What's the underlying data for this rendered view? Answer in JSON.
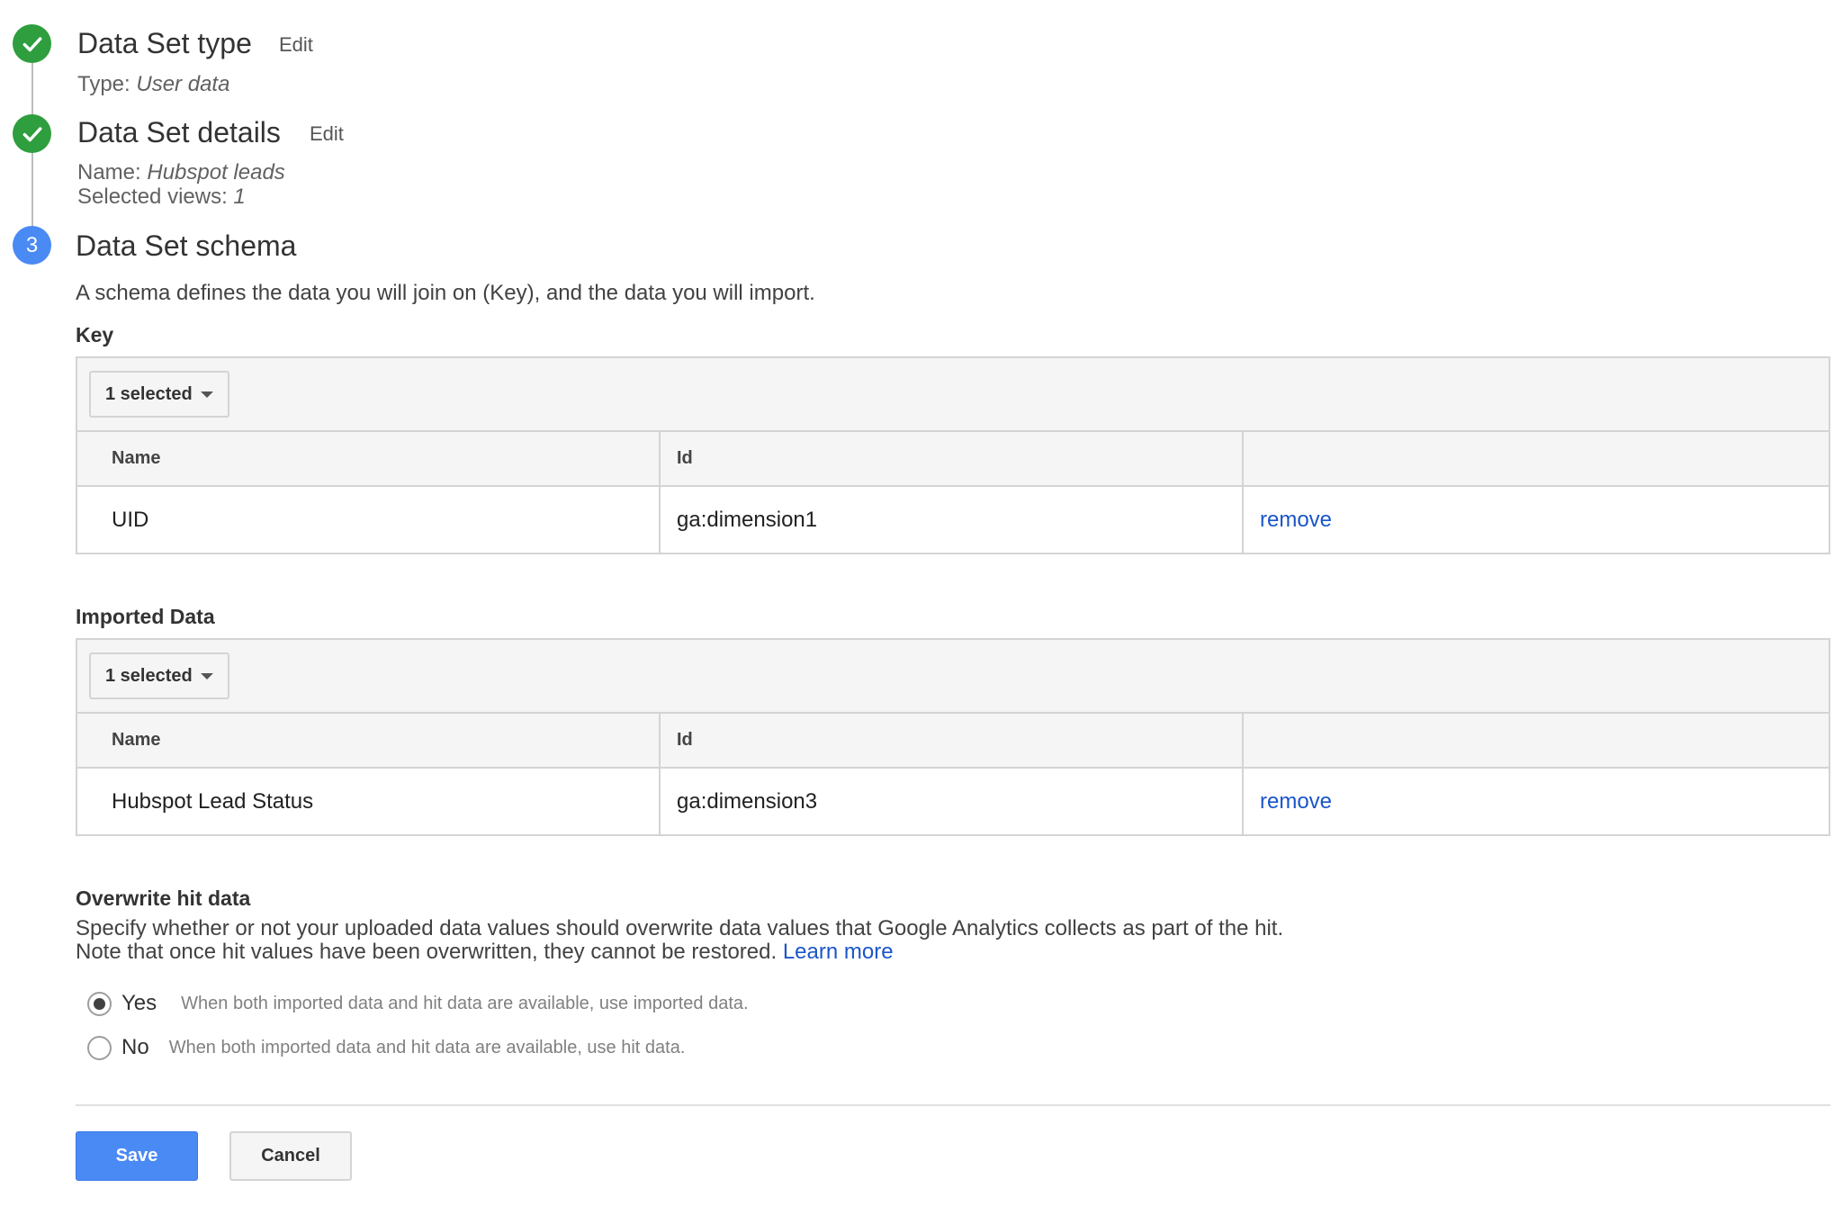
{
  "steps": [
    {
      "title": "Data Set type",
      "edit_label": "Edit",
      "summary": [
        {
          "label": "Type:",
          "value": "User data"
        }
      ]
    },
    {
      "title": "Data Set details",
      "edit_label": "Edit",
      "summary": [
        {
          "label": "Name:",
          "value": "Hubspot leads"
        },
        {
          "label": "Selected views:",
          "value": "1"
        }
      ]
    },
    {
      "number": "3",
      "title": "Data Set schema"
    }
  ],
  "schema": {
    "intro": "A schema defines the data you will join on (Key), and the data you will import.",
    "key": {
      "label": "Key",
      "dropdown": "1 selected",
      "headers": [
        "Name",
        "Id",
        ""
      ],
      "rows": [
        {
          "name": "UID",
          "id": "ga:dimension1",
          "action": "remove"
        }
      ]
    },
    "imported": {
      "label": "Imported Data",
      "dropdown": "1 selected",
      "headers": [
        "Name",
        "Id",
        ""
      ],
      "rows": [
        {
          "name": "Hubspot Lead Status",
          "id": "ga:dimension3",
          "action": "remove"
        }
      ]
    }
  },
  "overwrite": {
    "label": "Overwrite hit data",
    "desc_line1": "Specify whether or not your uploaded data values should overwrite data values that Google Analytics collects as part of the hit.",
    "desc_line2": "Note that once hit values have been overwritten, they cannot be restored.",
    "learn_more": "Learn more",
    "options": [
      {
        "label": "Yes",
        "help": "When both imported data and hit data are available, use imported data.",
        "checked": true
      },
      {
        "label": "No",
        "help": "When both imported data and hit data are available, use hit data.",
        "checked": false
      }
    ]
  },
  "actions": {
    "save": "Save",
    "cancel": "Cancel"
  },
  "colors": {
    "step_done": "#2e9e3e",
    "step_active": "#4a8af4",
    "link": "#1a56c9",
    "primary_button": "#4a8af4"
  }
}
